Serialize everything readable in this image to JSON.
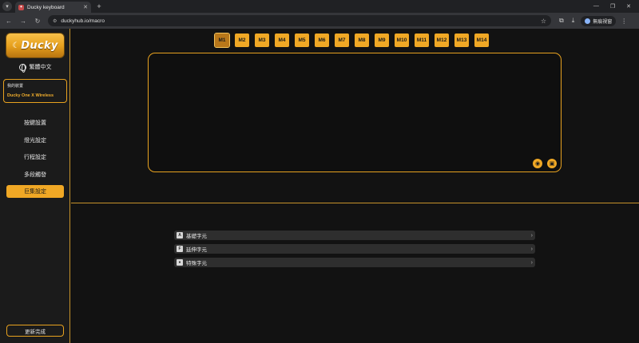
{
  "browser": {
    "tab_title": "Ducky keyboard",
    "url": "duckyhub.io/macro",
    "profile_label": "無痕視窗"
  },
  "sidebar": {
    "brand": "Ducky",
    "language": "繁體中文",
    "device_label": "我的裝置",
    "device_name": "Ducky One X Wireless",
    "items": [
      {
        "label": "按鍵設置"
      },
      {
        "label": "燈光設定"
      },
      {
        "label": "行程設定"
      },
      {
        "label": "多段觸發"
      },
      {
        "label": "巨集設定"
      }
    ],
    "active_index": 4,
    "update_button": "更新完成"
  },
  "macro": {
    "tabs": [
      "M1",
      "M2",
      "M3",
      "M4",
      "M5",
      "M6",
      "M7",
      "M8",
      "M9",
      "M10",
      "M11",
      "M12",
      "M13",
      "M14"
    ],
    "active_tab": "M1"
  },
  "key_lists": [
    {
      "icon": "A",
      "label": "基礎字元"
    },
    {
      "icon": "F",
      "label": "延伸字元"
    },
    {
      "icon": "●",
      "label": "特殊字元"
    }
  ],
  "colors": {
    "accent": "#f0a825",
    "background": "#121212",
    "sidebar": "#1b1b1b"
  }
}
